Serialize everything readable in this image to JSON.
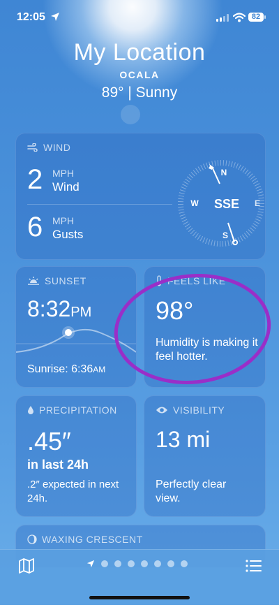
{
  "status_bar": {
    "time": "12:05",
    "battery": "82"
  },
  "header": {
    "title": "My Location",
    "city": "OCALA",
    "condition": "89° | Sunny"
  },
  "wind": {
    "heading": "WIND",
    "wind_value": "2",
    "wind_unit": "MPH",
    "wind_label": "Wind",
    "gust_value": "6",
    "gust_unit": "MPH",
    "gust_label": "Gusts",
    "direction": "SSE",
    "compass": {
      "n": "N",
      "e": "E",
      "s": "S",
      "w": "W"
    }
  },
  "sunset": {
    "heading": "SUNSET",
    "time": "8:32",
    "time_suffix": "PM",
    "sunrise_label": "Sunrise: 6:36",
    "sunrise_suffix": "AM"
  },
  "feels_like": {
    "heading": "FEELS LIKE",
    "value": "98°",
    "description": "Humidity is making it feel hotter."
  },
  "precipitation": {
    "heading": "PRECIPITATION",
    "value": ".45″",
    "period": "in last 24h",
    "description": ".2″ expected in next 24h."
  },
  "visibility": {
    "heading": "VISIBILITY",
    "value": "13 mi",
    "description": "Perfectly clear view."
  },
  "moon": {
    "heading": "WAXING CRESCENT"
  },
  "bottom_bar": {
    "page_count": 7
  },
  "colors": {
    "annotation_circle": "#9a2ec8",
    "background": "#4b92db"
  },
  "icons": [
    "location-arrow-icon",
    "wind-icon",
    "sunset-icon",
    "thermometer-icon",
    "droplet-icon",
    "eye-icon",
    "moon-icon",
    "map-icon",
    "list-icon"
  ]
}
